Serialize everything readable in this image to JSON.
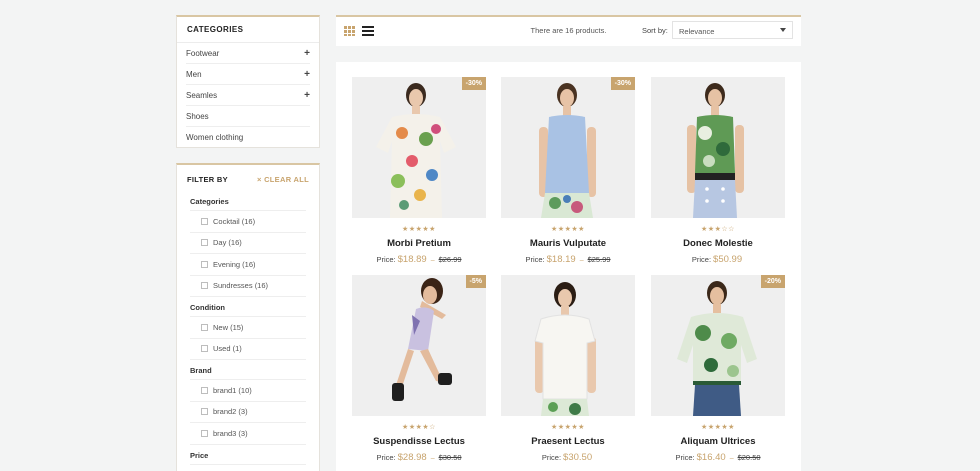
{
  "categories": {
    "title": "Categories",
    "items": [
      {
        "label": "Footwear",
        "expandable": true
      },
      {
        "label": "Men",
        "expandable": true
      },
      {
        "label": "Seamles",
        "expandable": true
      },
      {
        "label": "Shoes",
        "expandable": false
      },
      {
        "label": "Women clothing",
        "expandable": false
      }
    ],
    "expand_symbol": "+"
  },
  "filter": {
    "title": "Filter by",
    "clear_all": "Clear all",
    "clear_icon": "×",
    "facets": [
      {
        "title": "Categories",
        "options": [
          "Cocktail (16)",
          "Day (16)",
          "Evening (16)",
          "Sundresses (16)"
        ]
      },
      {
        "title": "Condition",
        "options": [
          "New (15)",
          "Used (1)"
        ]
      },
      {
        "title": "Brand",
        "options": [
          "brand1 (10)",
          "brand2 (3)",
          "brand3 (3)"
        ]
      },
      {
        "title": "Price",
        "options": []
      }
    ]
  },
  "toolbar": {
    "count_text": "There are 16 products.",
    "sort_label": "Sort by:",
    "sort_value": "Relevance"
  },
  "products": [
    {
      "name": "Morbi Pretium",
      "badge": "-30%",
      "rating": 5,
      "stars": "★★★★★",
      "price_label": "Price:",
      "price": "$18.89",
      "sep": "–",
      "old_price": "$26.99"
    },
    {
      "name": "Mauris Vulputate",
      "badge": "-30%",
      "rating": 5,
      "stars": "★★★★★",
      "price_label": "Price:",
      "price": "$18.19",
      "sep": "–",
      "old_price": "$25.99"
    },
    {
      "name": "Donec Molestie",
      "badge": "",
      "rating": 3,
      "stars": "★★★☆☆",
      "price_label": "Price:",
      "price": "$50.99",
      "sep": "",
      "old_price": ""
    },
    {
      "name": "Suspendisse Lectus",
      "badge": "-5%",
      "rating": 4,
      "stars": "★★★★☆",
      "price_label": "Price:",
      "price": "$28.98",
      "sep": "–",
      "old_price": "$30.50"
    },
    {
      "name": "Praesent Lectus",
      "badge": "",
      "rating": 5,
      "stars": "★★★★★",
      "price_label": "Price:",
      "price": "$30.50",
      "sep": "",
      "old_price": ""
    },
    {
      "name": "Aliquam Ultrices",
      "badge": "-20%",
      "rating": 5,
      "stars": "★★★★★",
      "price_label": "Price:",
      "price": "$16.40",
      "sep": "–",
      "old_price": "$20.50"
    }
  ],
  "colors": {
    "accent": "#c8a46e",
    "background": "#f3f4f4"
  }
}
